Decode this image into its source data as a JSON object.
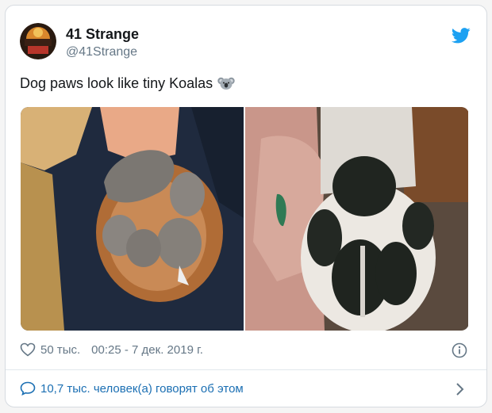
{
  "tweet": {
    "author_name": "41 Strange",
    "author_handle": "@41Strange",
    "text": "Dog paws look like tiny Koalas",
    "likes": "50 тыс.",
    "timestamp": "00:25 - 7 дек. 2019 г.",
    "people_talking": "10,7 тыс. человек(а) говорят об этом"
  },
  "icons": {
    "brand": "twitter-bird-icon",
    "emoji": "koala-emoji",
    "like": "heart-icon",
    "info": "info-icon",
    "reply": "speech-bubble-icon",
    "more": "chevron-right-icon"
  },
  "colors": {
    "twitter_blue": "#1da1f2",
    "link_blue": "#1b6fb3",
    "text_primary": "#14171a",
    "text_secondary": "#657786"
  }
}
